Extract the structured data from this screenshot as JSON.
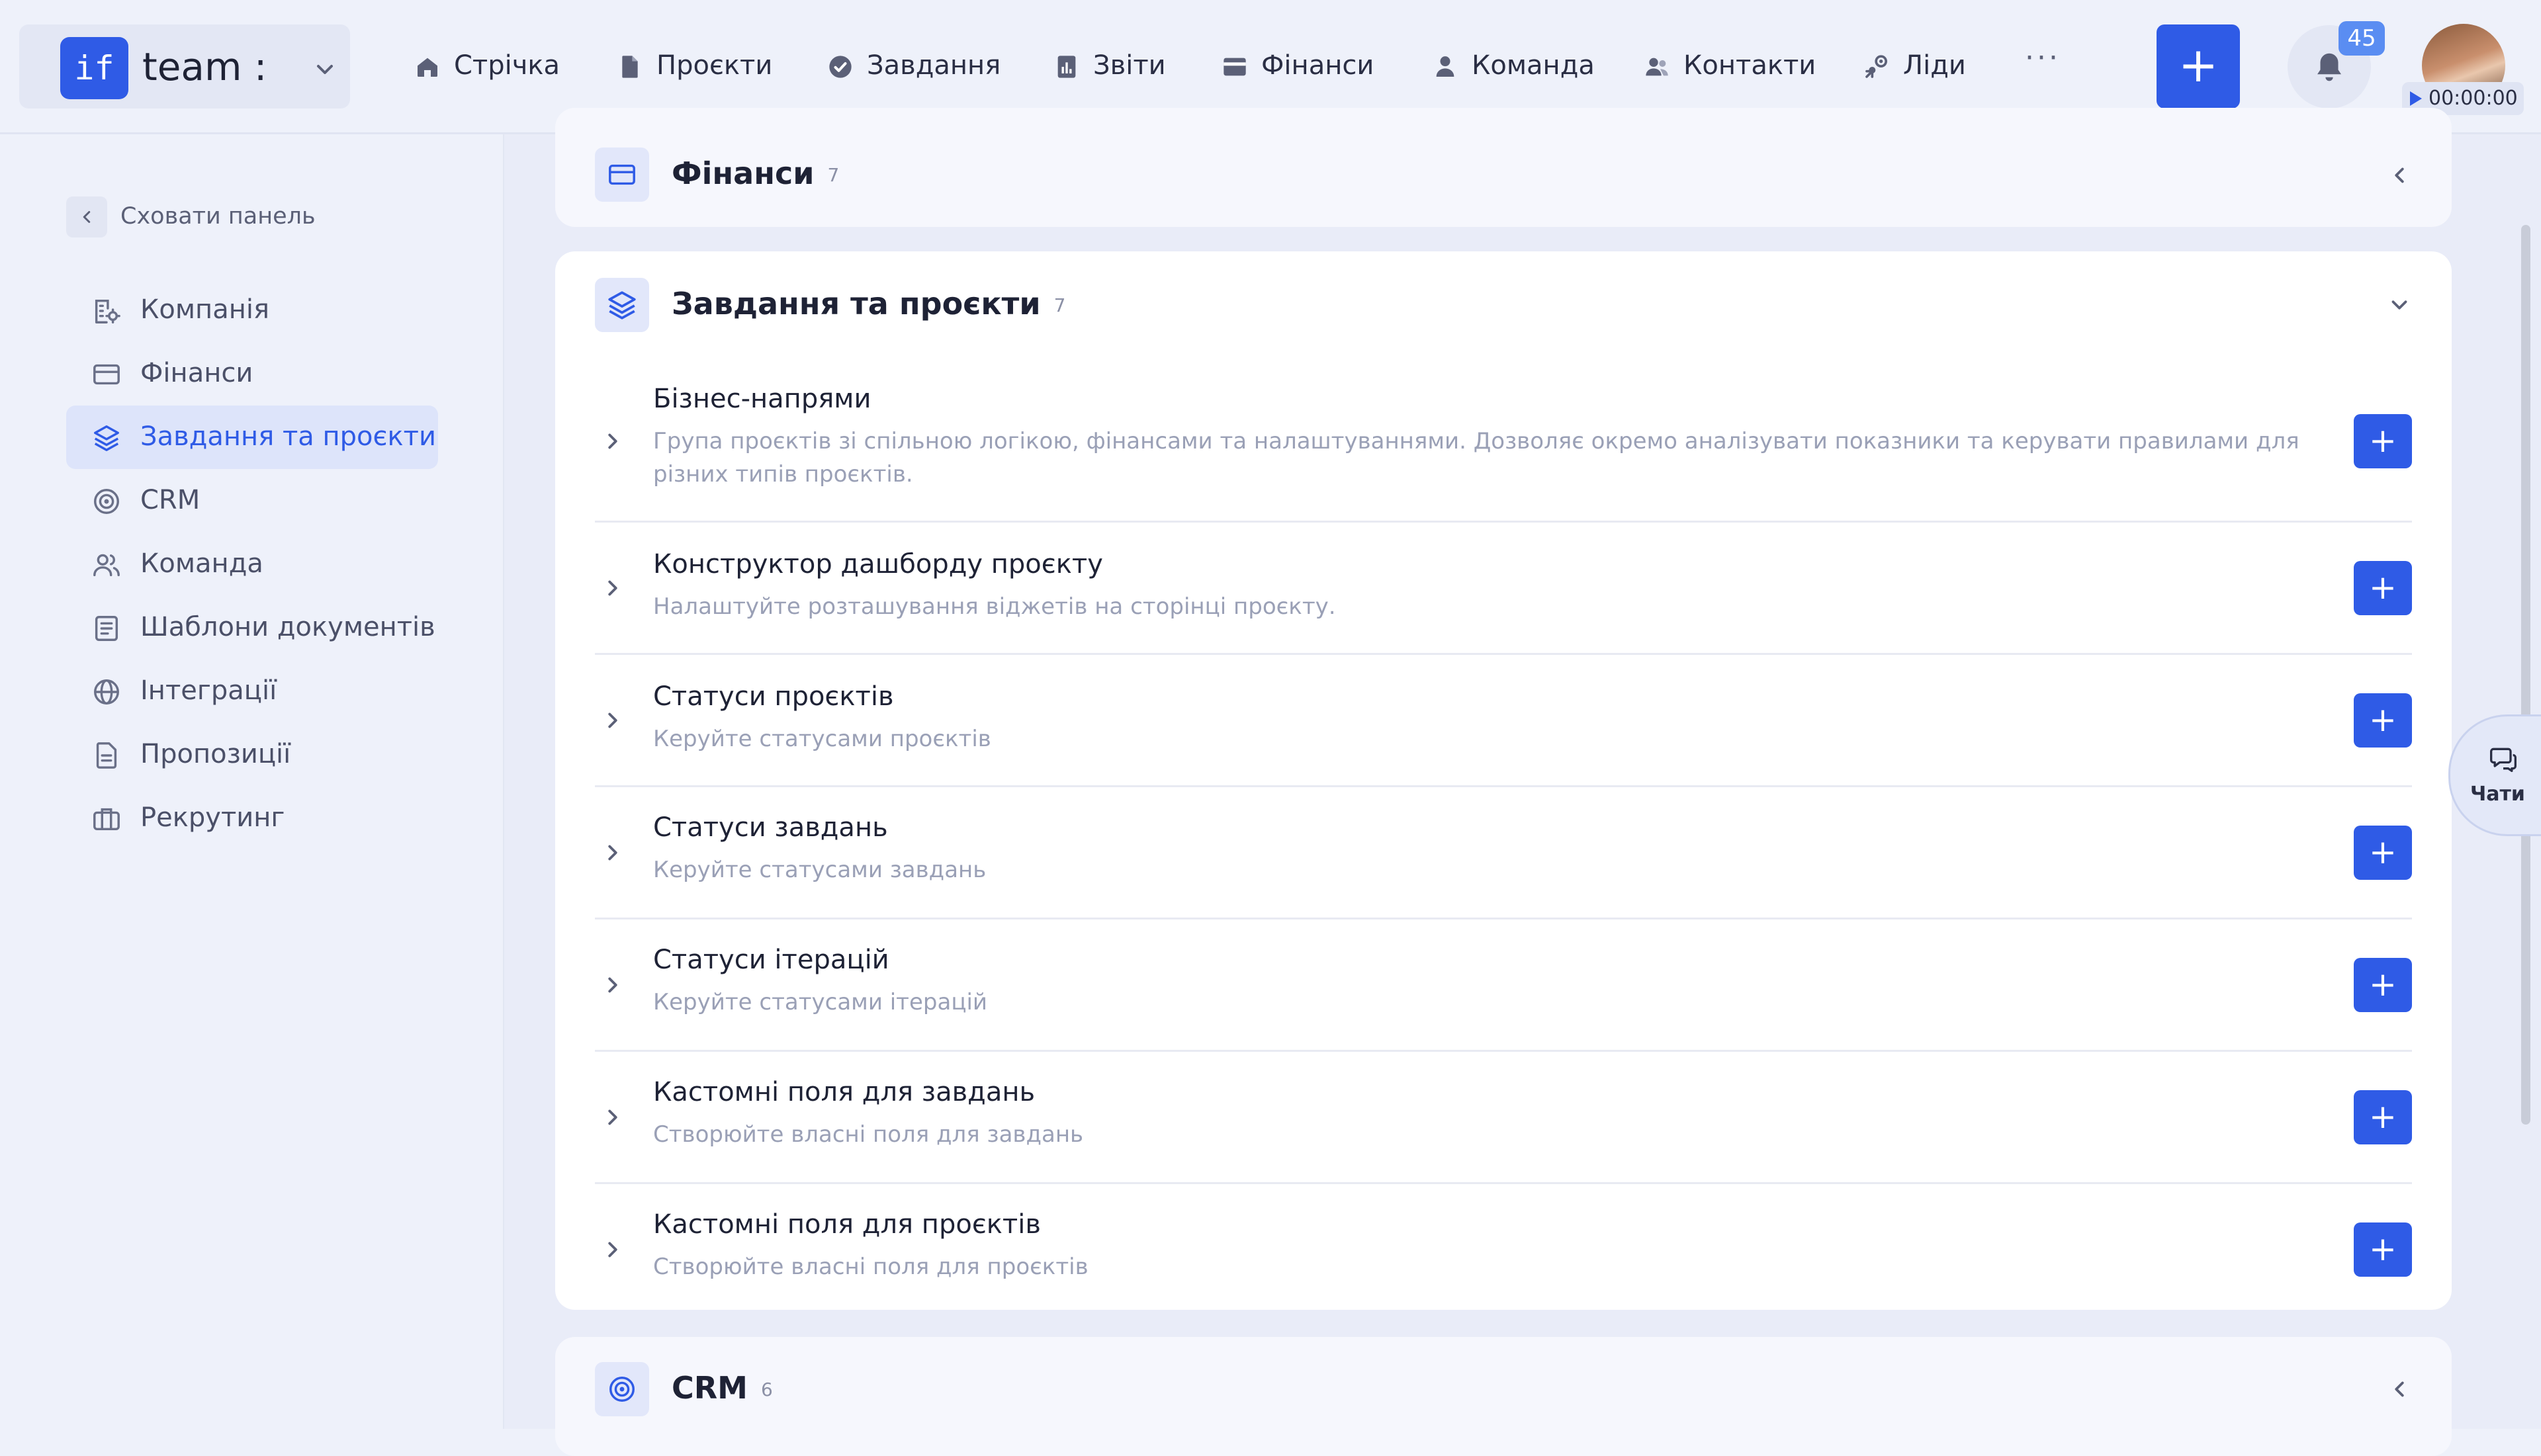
{
  "brand": {
    "logo": "if",
    "name": "team :"
  },
  "nav": [
    {
      "label": "Стрічка",
      "icon": "home-icon"
    },
    {
      "label": "Проєкти",
      "icon": "document-icon"
    },
    {
      "label": "Завдання",
      "icon": "check-circle-icon"
    },
    {
      "label": "Звіти",
      "icon": "report-icon"
    },
    {
      "label": "Фінанси",
      "icon": "wallet-icon"
    },
    {
      "label": "Команда",
      "icon": "user-icon"
    },
    {
      "label": "Контакти",
      "icon": "contacts-icon"
    },
    {
      "label": "Ліди",
      "icon": "leads-icon"
    }
  ],
  "nav_more": "···",
  "add_button": "+",
  "notifications": {
    "count": "45"
  },
  "timer": "00:00:00",
  "sidebar": {
    "hide_label": "Сховати панель",
    "items": [
      {
        "label": "Компанія",
        "icon": "company-icon"
      },
      {
        "label": "Фінанси",
        "icon": "card-icon"
      },
      {
        "label": "Завдання та проєкти",
        "icon": "layers-icon",
        "active": true
      },
      {
        "label": "CRM",
        "icon": "target-icon"
      },
      {
        "label": "Команда",
        "icon": "users-icon"
      },
      {
        "label": "Шаблони документів",
        "icon": "doc-template-icon"
      },
      {
        "label": "Інтеграції",
        "icon": "globe-icon"
      },
      {
        "label": "Пропозиції",
        "icon": "proposal-icon"
      },
      {
        "label": "Рекрутинг",
        "icon": "briefcase-icon"
      }
    ]
  },
  "sections": {
    "finance": {
      "title": "Фінанси",
      "count": "7"
    },
    "tasks": {
      "title": "Завдання та проєкти",
      "count": "7",
      "rows": [
        {
          "title": "Бізнес-напрями",
          "desc": "Група проєктів зі спільною логікою, фінансами та налаштуваннями. Дозволяє окремо аналізувати показники та керувати правилами для різних типів проєктів."
        },
        {
          "title": "Конструктор дашборду проєкту",
          "desc": "Налаштуйте розташування віджетів на сторінці проєкту."
        },
        {
          "title": "Статуси проєктів",
          "desc": "Керуйте статусами проєктів"
        },
        {
          "title": "Статуси завдань",
          "desc": "Керуйте статусами завдань"
        },
        {
          "title": "Статуси ітерацій",
          "desc": "Керуйте статусами ітерацій"
        },
        {
          "title": "Кастомні поля для завдань",
          "desc": "Створюйте власні поля для завдань"
        },
        {
          "title": "Кастомні поля для проєктів",
          "desc": "Створюйте власні поля для проєктів"
        }
      ],
      "row_add": "+"
    },
    "crm": {
      "title": "CRM",
      "count": "6"
    }
  },
  "chats": {
    "label": "Чати"
  },
  "colors": {
    "accent": "#2f5be6",
    "badge": "#5a8df2",
    "active_bg": "#dde4fa"
  }
}
